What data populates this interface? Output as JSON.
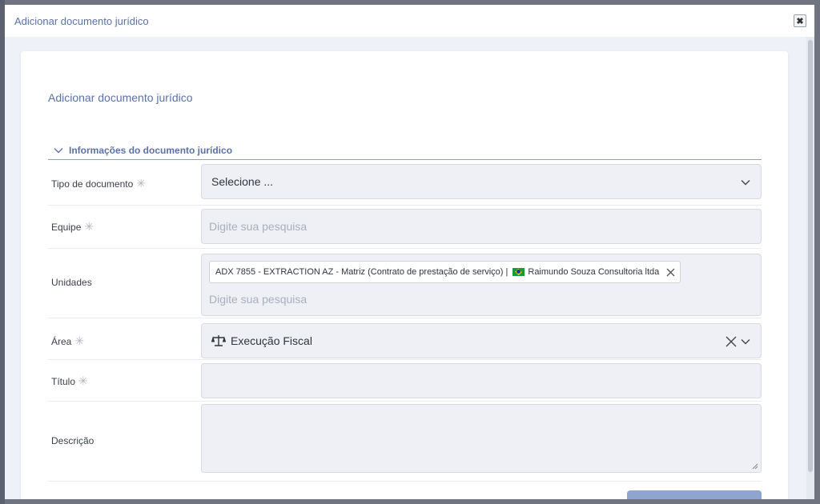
{
  "modal": {
    "title": "Adicionar documento jurídico",
    "close_glyph": "✖"
  },
  "card": {
    "title": "Adicionar documento jurídico",
    "section": "Informações do documento jurídico"
  },
  "fields": {
    "tipo": {
      "label": "Tipo de documento",
      "value": "Selecione ..."
    },
    "equipe": {
      "label": "Equipe",
      "placeholder": "Digite sua pesquisa"
    },
    "unidades": {
      "label": "Unidades",
      "tag_text": "ADX 7855 - EXTRACTION AZ - Matriz (Contrato de prestação de serviço) |",
      "tag_company": "Raimundo Souza Consultoria ltda",
      "placeholder": "Digite sua pesquisa"
    },
    "area": {
      "label": "Área",
      "value": "Execução Fiscal",
      "icon": "scale-icon"
    },
    "titulo": {
      "label": "Título"
    },
    "descricao": {
      "label": "Descrição"
    }
  },
  "required_mark": "✳",
  "colors": {
    "accent": "#5a72a8",
    "field_bg": "#eef0f5",
    "button": "#8fa4cf"
  }
}
